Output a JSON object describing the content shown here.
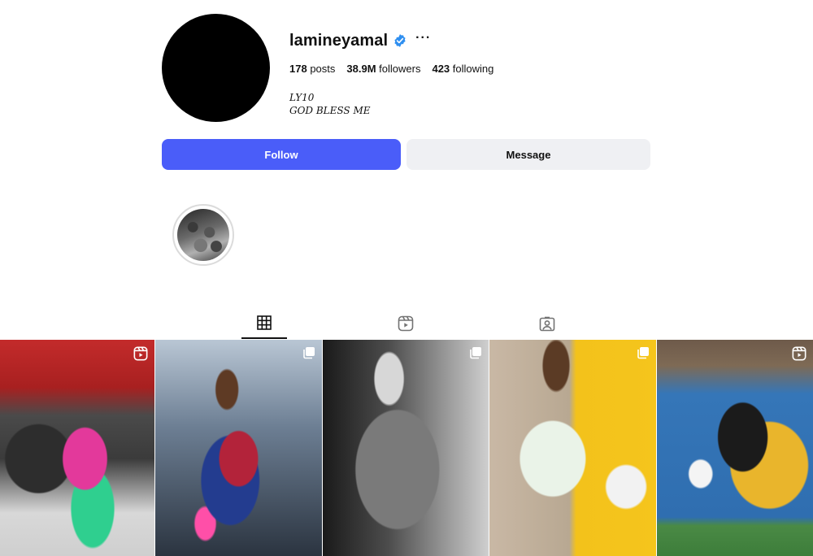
{
  "profile": {
    "username": "lamineyamal",
    "more_label": "···",
    "stats": {
      "posts_count": "178",
      "posts_label": "posts",
      "followers_count": "38.9M",
      "followers_label": "followers",
      "following_count": "423",
      "following_label": "following"
    },
    "bio": {
      "line1": "LY10",
      "line2": "GOD BLESS ME"
    }
  },
  "actions": {
    "follow_label": "Follow",
    "message_label": "Message"
  },
  "colors": {
    "follow_button": "#4a5df9",
    "message_button": "#eff0f3",
    "verified_badge": "#2f8ff0"
  },
  "tabs": [
    {
      "icon": "grid-icon",
      "active": true
    },
    {
      "icon": "reels-icon",
      "active": false
    },
    {
      "icon": "tagged-icon",
      "active": false
    }
  ],
  "posts": [
    {
      "type": "reel",
      "corner_icon": "reel-icon"
    },
    {
      "type": "carousel",
      "corner_icon": "carousel-icon"
    },
    {
      "type": "carousel",
      "corner_icon": "carousel-icon"
    },
    {
      "type": "carousel",
      "corner_icon": "carousel-icon"
    },
    {
      "type": "reel",
      "corner_icon": "reel-icon"
    }
  ]
}
